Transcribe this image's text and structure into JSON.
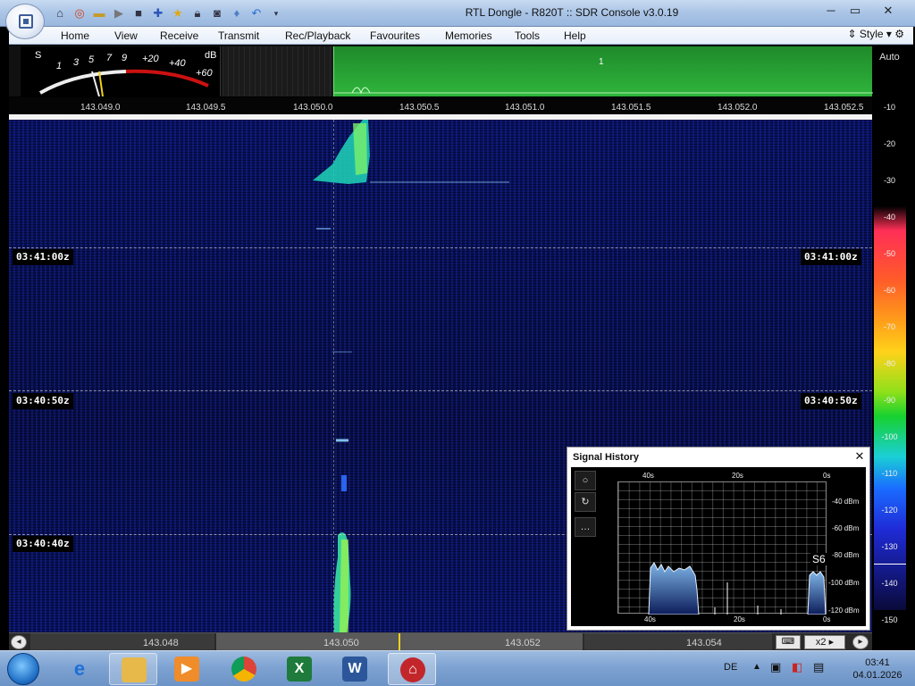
{
  "window": {
    "title": "RTL Dongle - R820T :: SDR Console v3.0.19"
  },
  "quick_access_icons": [
    "home-icon",
    "lifebuoy-icon",
    "folder-icon",
    "play-icon",
    "stop-icon",
    "plus-icon",
    "star-icon",
    "lock-icon",
    "camera-icon",
    "drop-icon",
    "undo-icon",
    "dropdown-icon"
  ],
  "menu": {
    "items": [
      "Home",
      "View",
      "Receive",
      "Transmit",
      "Rec/Playback",
      "Favourites",
      "Memories",
      "Tools",
      "Help"
    ],
    "style_label": "Style"
  },
  "smeter": {
    "s_label": "S",
    "db_label": "dB",
    "scale": [
      "1",
      "3",
      "5",
      "7",
      "9",
      "+20",
      "+40",
      "+60"
    ]
  },
  "mini_spectrum": {
    "vfo_label": "1"
  },
  "freq_ruler": {
    "ticks": [
      "143.049.0",
      "143.049.5",
      "143.050.0",
      "143.050.5",
      "143.051.0",
      "143.051.5",
      "143.052.0",
      "143.052.5"
    ]
  },
  "waterfall": {
    "timestamps": [
      "03:41:00z",
      "03:40:50z",
      "03:40:40z"
    ]
  },
  "db_scale": {
    "mode": "Auto",
    "ticks": [
      "-10",
      "-20",
      "-30",
      "-40",
      "-50",
      "-60",
      "-70",
      "-80",
      "-90",
      "-100",
      "-110",
      "-120",
      "-130",
      "-140",
      "-150"
    ]
  },
  "bottom_bar": {
    "labels": [
      "143.048",
      "143.050",
      "143.052",
      "143.054"
    ],
    "zoom": "x2"
  },
  "signal_history": {
    "title": "Signal History",
    "x_top": [
      "40s",
      "20s",
      "0s"
    ],
    "x_bottom": [
      "40s",
      "20s",
      "0s"
    ],
    "y_labels": [
      "-40 dBm",
      "-60 dBm",
      "-80 dBm",
      "-100 dBm",
      "-120 dBm"
    ],
    "current_s": "S6",
    "controls": [
      "○",
      "↻",
      "…"
    ]
  },
  "taskbar": {
    "apps": [
      "Internet Explorer",
      "Explorer",
      "Media Player",
      "Chrome",
      "Excel",
      "Word",
      "SDR Console"
    ],
    "language": "DE",
    "time": "03:41",
    "date": "04.01.2026"
  }
}
